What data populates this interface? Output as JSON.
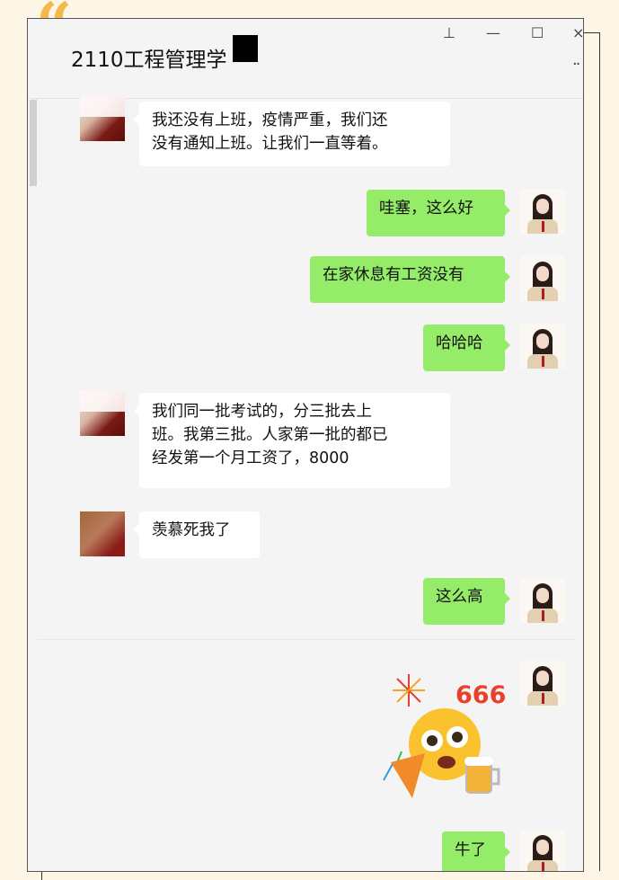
{
  "decor": {
    "quote_mark": "“"
  },
  "window": {
    "title": "2110工程管理学",
    "buttons": {
      "pin": "⊥",
      "minimize": "—",
      "maximize": "☐",
      "close": "×"
    },
    "more": "··"
  },
  "messages": [
    {
      "sender": "other",
      "text": "我还没有上班，疫情严重，我们还\n没有通知上班。让我们一直等着。"
    },
    {
      "sender": "me",
      "text": "哇塞，这么好"
    },
    {
      "sender": "me",
      "text": "在家休息有工资没有"
    },
    {
      "sender": "me",
      "text": "哈哈哈"
    },
    {
      "sender": "other",
      "text": "我们同一批考试的，分三批去上\n班。我第三批。人家第一批的都已\n经发第一个月工资了，8000"
    },
    {
      "sender": "other",
      "text": "羡慕死我了"
    },
    {
      "sender": "me",
      "text": "这么高"
    },
    {
      "sender": "me",
      "type": "sticker",
      "text": "666"
    },
    {
      "sender": "me",
      "text": "牛了"
    }
  ],
  "colors": {
    "my_bubble": "#95ec69",
    "other_bubble": "#ffffff",
    "background": "#f4f4f4"
  }
}
